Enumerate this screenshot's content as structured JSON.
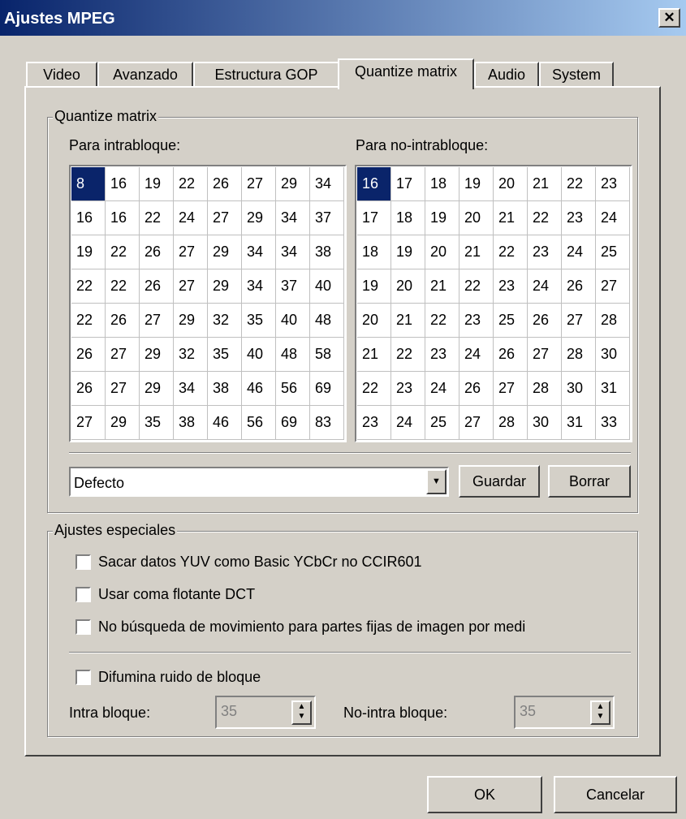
{
  "window": {
    "title": "Ajustes MPEG",
    "close_symbol": "✕"
  },
  "tabs": [
    "Video",
    "Avanzado",
    "Estructura GOP",
    "Quantize matrix",
    "Audio",
    "System"
  ],
  "quantize": {
    "group_label": "Quantize matrix",
    "intra_label": "Para intrabloque:",
    "nonintra_label": "Para no-intrabloque:",
    "intra_matrix": [
      [
        8,
        16,
        19,
        22,
        26,
        27,
        29,
        34
      ],
      [
        16,
        16,
        22,
        24,
        27,
        29,
        34,
        37
      ],
      [
        19,
        22,
        26,
        27,
        29,
        34,
        34,
        38
      ],
      [
        22,
        22,
        26,
        27,
        29,
        34,
        37,
        40
      ],
      [
        22,
        26,
        27,
        29,
        32,
        35,
        40,
        48
      ],
      [
        26,
        27,
        29,
        32,
        35,
        40,
        48,
        58
      ],
      [
        26,
        27,
        29,
        34,
        38,
        46,
        56,
        69
      ],
      [
        27,
        29,
        35,
        38,
        46,
        56,
        69,
        83
      ]
    ],
    "nonintra_matrix": [
      [
        16,
        17,
        18,
        19,
        20,
        21,
        22,
        23
      ],
      [
        17,
        18,
        19,
        20,
        21,
        22,
        23,
        24
      ],
      [
        18,
        19,
        20,
        21,
        22,
        23,
        24,
        25
      ],
      [
        19,
        20,
        21,
        22,
        23,
        24,
        26,
        27
      ],
      [
        20,
        21,
        22,
        23,
        25,
        26,
        27,
        28
      ],
      [
        21,
        22,
        23,
        24,
        26,
        27,
        28,
        30
      ],
      [
        22,
        23,
        24,
        26,
        27,
        28,
        30,
        31
      ],
      [
        23,
        24,
        25,
        27,
        28,
        30,
        31,
        33
      ]
    ],
    "preset_value": "Defecto",
    "save_label": "Guardar",
    "delete_label": "Borrar"
  },
  "special": {
    "group_label": "Ajustes especiales",
    "checkboxes": [
      "Sacar datos YUV como Basic YCbCr no CCIR601",
      "Usar coma flotante DCT",
      "No búsqueda de movimiento para partes fijas de imagen por medi"
    ],
    "dither_label": "Difumina ruido de bloque",
    "intra_label": "Intra bloque:",
    "intra_value": "35",
    "nonintra_label": "No-intra bloque:",
    "nonintra_value": "35"
  },
  "footer": {
    "ok_label": "OK",
    "cancel_label": "Cancelar"
  }
}
